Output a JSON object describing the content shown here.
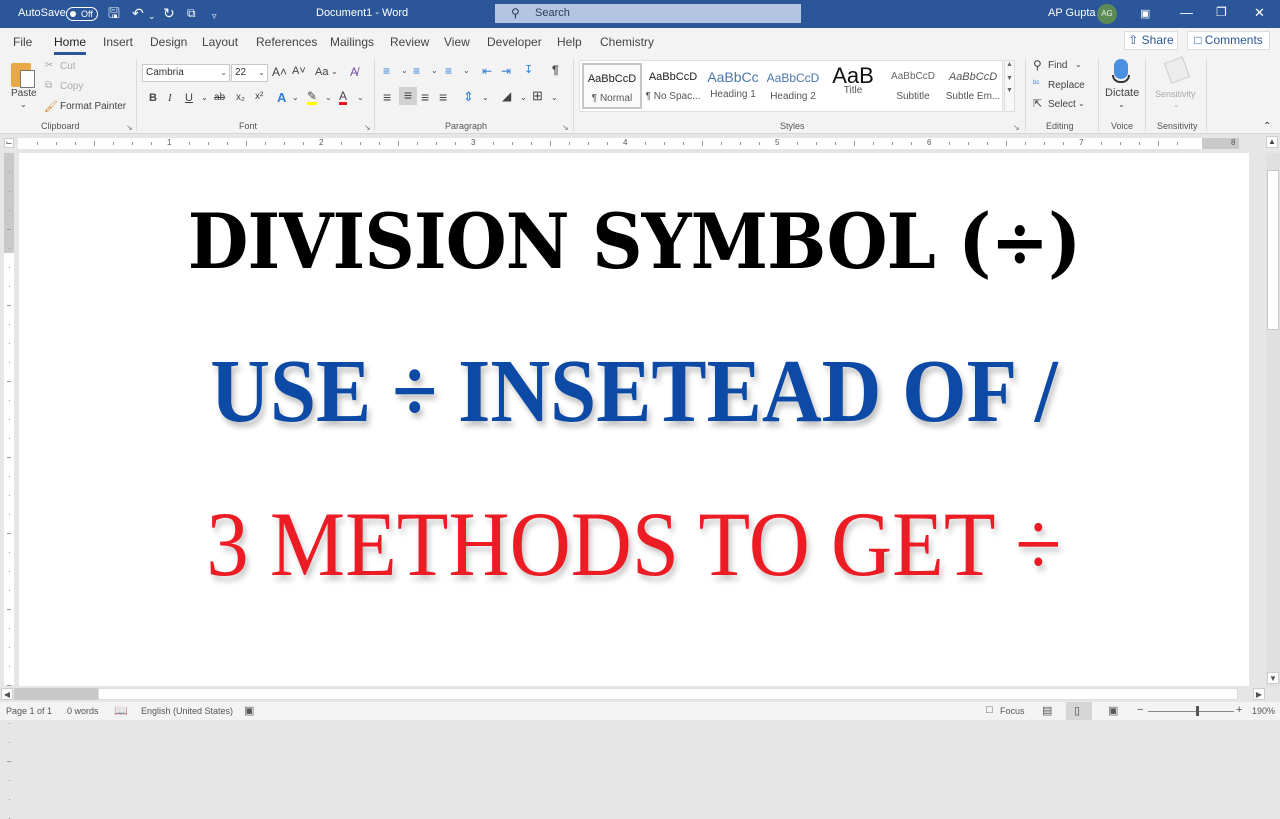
{
  "titlebar": {
    "autosave_label": "AutoSave",
    "autosave_state": "Off",
    "document_title": "Document1  -  Word",
    "search_placeholder": "Search",
    "user_name": "AP Gupta",
    "user_initials": "AG",
    "quick_access": [
      "save-icon",
      "undo-icon",
      "redo-icon",
      "touch-mode-icon",
      "customize-icon"
    ]
  },
  "tabs": {
    "items": [
      "File",
      "Home",
      "Insert",
      "Design",
      "Layout",
      "References",
      "Mailings",
      "Review",
      "View",
      "Developer",
      "Help",
      "Chemistry"
    ],
    "active": "Home",
    "share_label": "Share",
    "comments_label": "Comments"
  },
  "ribbon": {
    "clipboard": {
      "label": "Clipboard",
      "paste": "Paste",
      "cut": "Cut",
      "copy": "Copy",
      "format_painter": "Format Painter"
    },
    "font": {
      "label": "Font",
      "font_name": "Cambria",
      "font_size": "22",
      "bold": "B",
      "italic": "I",
      "underline": "U",
      "strike": "ab",
      "subscript": "x₂",
      "superscript": "x²",
      "grow": "A˄",
      "shrink": "A˅",
      "change_case": "Aa",
      "highlight_color": "#ffff00",
      "font_color": "#e81123"
    },
    "paragraph": {
      "label": "Paragraph",
      "pilcrow": "¶"
    },
    "styles": {
      "label": "Styles",
      "items": [
        {
          "preview": "AaBbCcD",
          "name": "¶ Normal",
          "selected": true
        },
        {
          "preview": "AaBbCcD",
          "name": "¶ No Spac..."
        },
        {
          "preview": "AaBbCc",
          "name": "Heading 1"
        },
        {
          "preview": "AaBbCcD",
          "name": "Heading 2"
        },
        {
          "preview": "AaB",
          "name": "Title"
        },
        {
          "preview": "AaBbCcD",
          "name": "Subtitle"
        },
        {
          "preview": "AaBbCcD",
          "name": "Subtle Em..."
        }
      ]
    },
    "editing": {
      "label": "Editing",
      "find": "Find",
      "replace": "Replace",
      "select": "Select"
    },
    "voice": {
      "label": "Voice",
      "dictate": "Dictate"
    },
    "sensitivity": {
      "label": "Sensitivity",
      "button": "Sensitivity"
    }
  },
  "ruler": {
    "numbers": [
      "1",
      "2",
      "3",
      "4",
      "5",
      "6",
      "7",
      "8"
    ]
  },
  "document": {
    "line1": "DIVISION SYMBOL (÷)",
    "line2": "USE ÷ INSETEAD OF /",
    "line3": "3 METHODS TO GET ÷",
    "colors": {
      "line1": "#000000",
      "line2": "#0d4aa6",
      "line3": "#ec1c24"
    }
  },
  "status": {
    "page": "Page 1 of 1",
    "words": "0 words",
    "language": "English (United States)",
    "focus": "Focus",
    "zoom": "190%"
  }
}
